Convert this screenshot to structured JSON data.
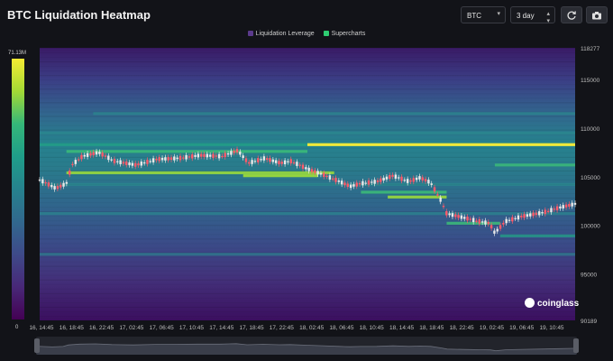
{
  "header": {
    "title": "BTC Liquidation Heatmap",
    "symbol": "BTC",
    "range": "3 day",
    "refresh_icon": "refresh-icon",
    "camera_icon": "camera-icon"
  },
  "legend": [
    {
      "label": "Liquidation Leverage",
      "color": "#5b3a8c"
    },
    {
      "label": "Supercharts",
      "color": "#2ecc71"
    }
  ],
  "colorbar": {
    "max_label": "71.13M",
    "min_label": "0"
  },
  "watermark": "coinglass",
  "chart_data": {
    "type": "heatmap",
    "title": "BTC Liquidation Heatmap",
    "y_axis": {
      "range": [
        90189,
        118277
      ],
      "ticks": [
        118277,
        115000,
        110000,
        105000,
        100000,
        95000,
        90189
      ],
      "tick_labels": [
        "118277",
        "115000",
        "110000",
        "105000",
        "100000",
        "95000",
        "90189"
      ]
    },
    "x_axis": {
      "tick_labels": [
        "16, 14:45",
        "16, 18:45",
        "16, 22:45",
        "17, 02:45",
        "17, 06:45",
        "17, 10:45",
        "17, 14:45",
        "17, 18:45",
        "17, 22:45",
        "18, 02:45",
        "18, 06:45",
        "18, 10:45",
        "18, 14:45",
        "18, 18:45",
        "18, 22:45",
        "19, 02:45",
        "19, 06:45",
        "19, 10:45"
      ]
    },
    "colorscale": {
      "min": 0,
      "max": "71.13M",
      "colors": [
        "#440154",
        "#482878",
        "#3e4a89",
        "#31688e",
        "#26828e",
        "#1f9e89",
        "#35b779",
        "#a3d935",
        "#f5eb33"
      ]
    },
    "price_series": [
      {
        "t": 0.0,
        "price": 104700
      },
      {
        "t": 0.03,
        "price": 103800
      },
      {
        "t": 0.05,
        "price": 104300
      },
      {
        "t": 0.06,
        "price": 106200
      },
      {
        "t": 0.08,
        "price": 107100
      },
      {
        "t": 0.11,
        "price": 107500
      },
      {
        "t": 0.14,
        "price": 106600
      },
      {
        "t": 0.18,
        "price": 106200
      },
      {
        "t": 0.22,
        "price": 106800
      },
      {
        "t": 0.26,
        "price": 106900
      },
      {
        "t": 0.3,
        "price": 107200
      },
      {
        "t": 0.34,
        "price": 107100
      },
      {
        "t": 0.37,
        "price": 107700
      },
      {
        "t": 0.39,
        "price": 106400
      },
      {
        "t": 0.42,
        "price": 106900
      },
      {
        "t": 0.45,
        "price": 106400
      },
      {
        "t": 0.47,
        "price": 106600
      },
      {
        "t": 0.5,
        "price": 105800
      },
      {
        "t": 0.53,
        "price": 105200
      },
      {
        "t": 0.56,
        "price": 104500
      },
      {
        "t": 0.58,
        "price": 104000
      },
      {
        "t": 0.6,
        "price": 104300
      },
      {
        "t": 0.63,
        "price": 104500
      },
      {
        "t": 0.66,
        "price": 105100
      },
      {
        "t": 0.69,
        "price": 104500
      },
      {
        "t": 0.71,
        "price": 104900
      },
      {
        "t": 0.73,
        "price": 104400
      },
      {
        "t": 0.75,
        "price": 102500
      },
      {
        "t": 0.76,
        "price": 101200
      },
      {
        "t": 0.79,
        "price": 100800
      },
      {
        "t": 0.82,
        "price": 100400
      },
      {
        "t": 0.84,
        "price": 100200
      },
      {
        "t": 0.85,
        "price": 99200
      },
      {
        "t": 0.87,
        "price": 100400
      },
      {
        "t": 0.9,
        "price": 100900
      },
      {
        "t": 0.94,
        "price": 101300
      },
      {
        "t": 0.97,
        "price": 101800
      },
      {
        "t": 1.0,
        "price": 102200
      }
    ],
    "liquidation_bands": [
      {
        "price": 108300,
        "t_start": 0.0,
        "t_end": 1.0,
        "intensity": 0.45
      },
      {
        "price": 108300,
        "t_start": 0.5,
        "t_end": 1.0,
        "intensity": 1.0
      },
      {
        "price": 107600,
        "t_start": 0.05,
        "t_end": 0.5,
        "intensity": 0.6
      },
      {
        "price": 105400,
        "t_start": 0.05,
        "t_end": 0.55,
        "intensity": 0.75
      },
      {
        "price": 105100,
        "t_start": 0.38,
        "t_end": 0.52,
        "intensity": 0.9
      },
      {
        "price": 103400,
        "t_start": 0.6,
        "t_end": 0.76,
        "intensity": 0.65
      },
      {
        "price": 102900,
        "t_start": 0.65,
        "t_end": 0.76,
        "intensity": 0.8
      },
      {
        "price": 100200,
        "t_start": 0.76,
        "t_end": 0.86,
        "intensity": 0.6
      },
      {
        "price": 98900,
        "t_start": 0.86,
        "t_end": 1.0,
        "intensity": 0.4
      },
      {
        "price": 111500,
        "t_start": 0.1,
        "t_end": 1.0,
        "intensity": 0.3
      },
      {
        "price": 109500,
        "t_start": 0.0,
        "t_end": 1.0,
        "intensity": 0.35
      },
      {
        "price": 106200,
        "t_start": 0.85,
        "t_end": 1.0,
        "intensity": 0.55
      },
      {
        "price": 104200,
        "t_start": 0.0,
        "t_end": 1.0,
        "intensity": 0.3
      },
      {
        "price": 101200,
        "t_start": 0.0,
        "t_end": 1.0,
        "intensity": 0.25
      },
      {
        "price": 97000,
        "t_start": 0.0,
        "t_end": 1.0,
        "intensity": 0.15
      }
    ]
  }
}
